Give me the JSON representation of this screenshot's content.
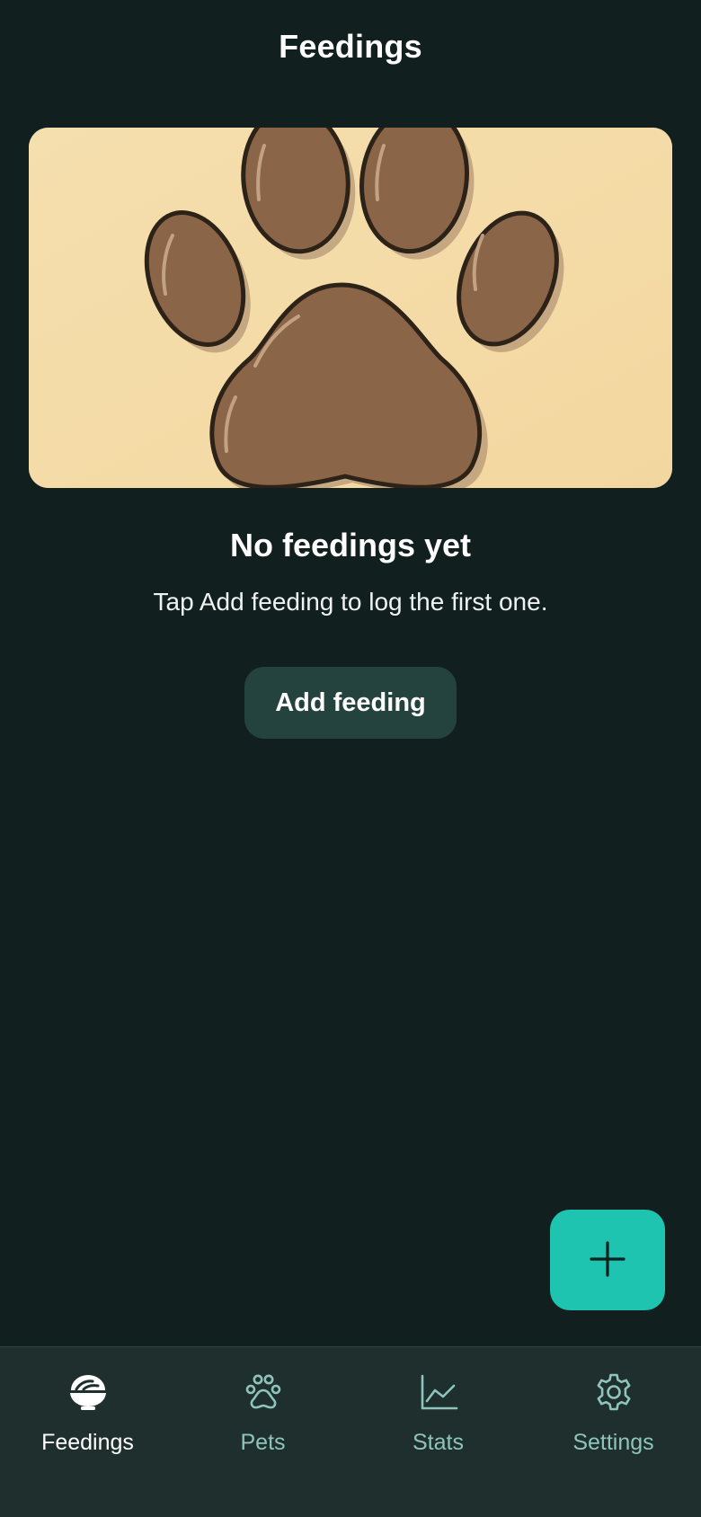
{
  "header": {
    "title": "Feedings"
  },
  "empty_state": {
    "image_icon": "paw-print-illustration",
    "title": "No feedings yet",
    "subtitle": "Tap Add feeding to log the first one.",
    "button_label": "Add feeding"
  },
  "fab": {
    "icon": "plus-icon"
  },
  "bottom_nav": {
    "items": [
      {
        "label": "Feedings",
        "icon": "bowl-icon",
        "active": true
      },
      {
        "label": "Pets",
        "icon": "paw-icon",
        "active": false
      },
      {
        "label": "Stats",
        "icon": "chart-icon",
        "active": false
      },
      {
        "label": "Settings",
        "icon": "gear-icon",
        "active": false
      }
    ]
  },
  "colors": {
    "background": "#121f1f",
    "accent": "#1fc4b0",
    "button": "#24433f",
    "nav_bar": "#1e2f2e",
    "nav_inactive": "#8fc4bc",
    "hero_background": "#f5dca8",
    "paw": "#8a6548"
  }
}
